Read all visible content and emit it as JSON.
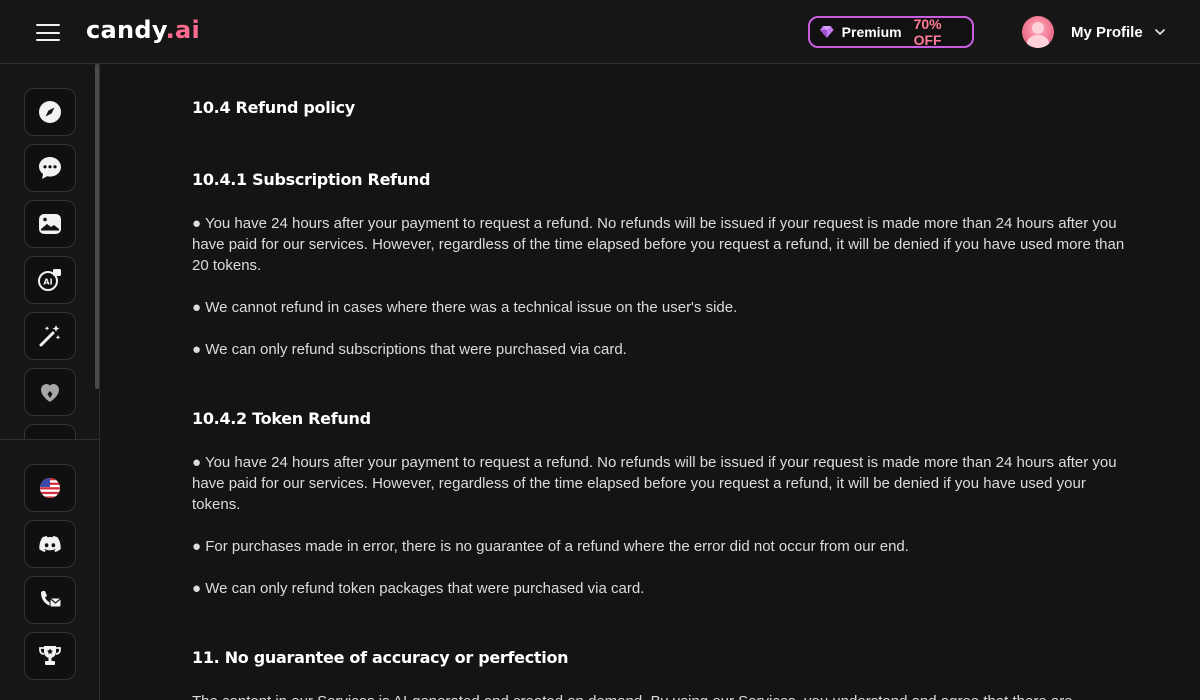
{
  "header": {
    "logo_main": "candy",
    "logo_accent": ".ai",
    "premium_label": "Premium",
    "premium_discount": "70% OFF",
    "profile_label": "My Profile"
  },
  "sidebar": {
    "top_items": [
      {
        "icon": "compass-icon"
      },
      {
        "icon": "chat-icon"
      },
      {
        "icon": "gallery-icon"
      },
      {
        "icon": "ai-generate-icon"
      },
      {
        "icon": "magic-wand-icon"
      },
      {
        "icon": "heart-icon"
      }
    ],
    "bottom_items": [
      {
        "icon": "us-flag-icon"
      },
      {
        "icon": "discord-icon"
      },
      {
        "icon": "contact-icon"
      },
      {
        "icon": "trophy-icon"
      }
    ]
  },
  "content": {
    "sections": [
      {
        "type": "heading",
        "text": "10.4 Refund policy"
      },
      {
        "type": "heading",
        "text": "10.4.1 Subscription Refund"
      },
      {
        "type": "paragraph",
        "text": "● You have 24 hours after your payment to request a refund. No refunds will be issued if your request is made more than 24 hours after you have paid for our services. However, regardless of the time elapsed before you request a refund, it will be denied if you have used more than 20 tokens."
      },
      {
        "type": "paragraph",
        "text": "● We cannot refund in cases where there was a technical issue on the user's side."
      },
      {
        "type": "paragraph",
        "text": "● We can only refund subscriptions that were purchased via card."
      },
      {
        "type": "heading",
        "text": "10.4.2 Token Refund"
      },
      {
        "type": "paragraph",
        "text": "● You have 24 hours after your payment to request a refund. No refunds will be issued if your request is made more than 24 hours after you have paid for our services. However, regardless of the time elapsed before you request a refund, it will be denied if you have used your tokens."
      },
      {
        "type": "paragraph",
        "text": "● For purchases made in error, there is no guarantee of a refund where the error did not occur from our end."
      },
      {
        "type": "paragraph",
        "text": "● We can only refund token packages that were purchased via card."
      },
      {
        "type": "heading",
        "text": "11. No guarantee of accuracy or perfection"
      },
      {
        "type": "paragraph",
        "text": "The content in our Services is AI-generated and created on demand. By using our Services, you understand and agree that there are"
      }
    ]
  },
  "colors": {
    "background": "#141414",
    "accent": "#ff6b8f",
    "premium_border": "#c95ce0"
  }
}
